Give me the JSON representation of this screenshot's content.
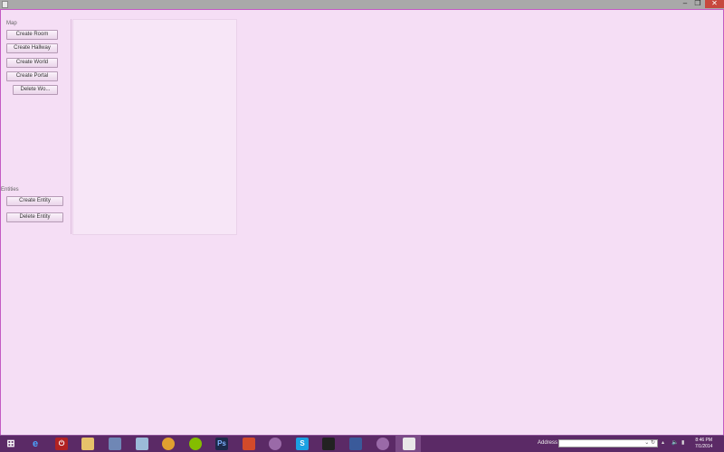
{
  "window": {
    "controls": {
      "minimize": "–",
      "maximize": "❐",
      "close": "✕"
    }
  },
  "sidebar": {
    "map_label": "Map",
    "map_buttons": [
      "Create Room",
      "Create Hallway",
      "Create World",
      "Create Portal",
      "Delete Wo..."
    ],
    "entities_label": "Entities",
    "entity_buttons": [
      "Create Entity",
      "Delete Entity"
    ]
  },
  "taskbar": {
    "apps": [
      "start-icon",
      "ie-icon",
      "power-icon",
      "file-explorer-icon",
      "app-icon",
      "notepad-icon",
      "chrome-icon",
      "spotify-icon",
      "photoshop-icon",
      "office-icon",
      "media-icon",
      "skype-icon",
      "steam-icon",
      "app2-icon",
      "media2-icon",
      "java-icon"
    ],
    "address_label": "Address",
    "address_value": "",
    "time": "8:46 PM",
    "date": "7/1/2014"
  },
  "colors": {
    "background": "#f5def5",
    "titlebar": "#a9a9a9",
    "close": "#c7483e",
    "taskbar": "#5b2a66"
  }
}
